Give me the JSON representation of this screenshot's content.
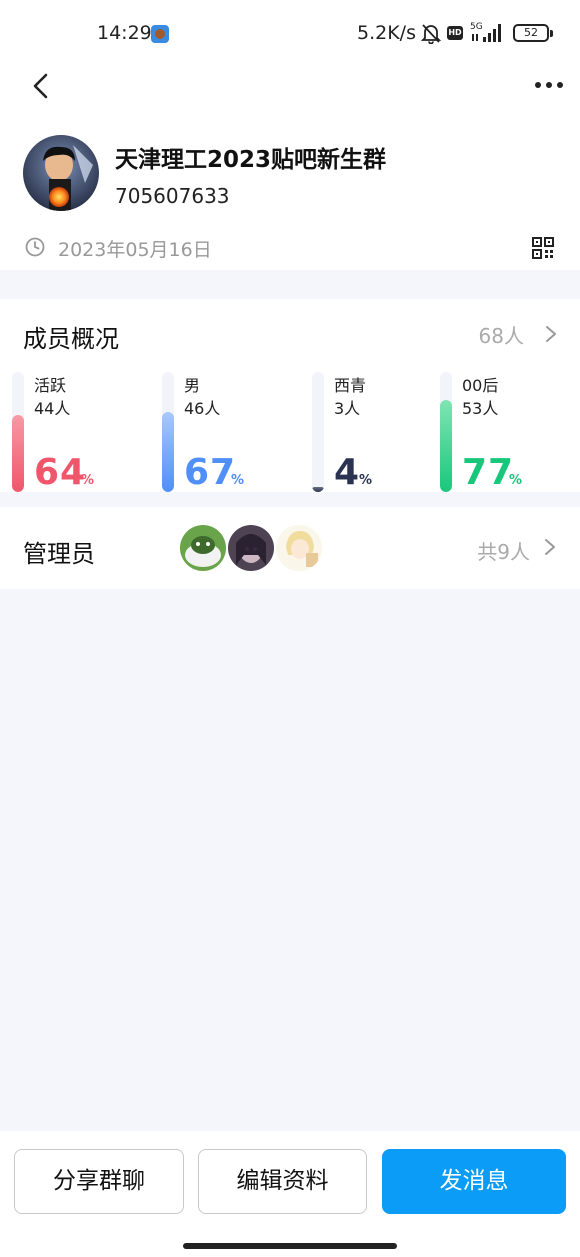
{
  "status_bar": {
    "time": "14:29",
    "network_speed": "5.2K/s",
    "signal": "5G",
    "battery": "52"
  },
  "header": {
    "group_name": "天津理工2023贴吧新生群",
    "group_id": "705607633",
    "created_date": "2023年05月16日"
  },
  "members": {
    "title": "成员概况",
    "total": "68人",
    "stats": [
      {
        "label": "活跃",
        "count": "44人",
        "percent": "64",
        "sign": "%",
        "value": 64,
        "color": "#f0566a",
        "fill_from": "#f79aa5"
      },
      {
        "label": "男",
        "count": "46人",
        "percent": "67",
        "sign": "%",
        "value": 67,
        "color": "#4f8ff7",
        "fill_from": "#a8c8fb"
      },
      {
        "label": "西青",
        "count": "3人",
        "percent": "4",
        "sign": "%",
        "value": 4,
        "color": "#2b3352",
        "fill_from": "#6b7184"
      },
      {
        "label": "00后",
        "count": "53人",
        "percent": "77",
        "sign": "%",
        "value": 77,
        "color": "#19c77a",
        "fill_from": "#7fe5b3"
      }
    ]
  },
  "admins": {
    "title": "管理员",
    "count": "共9人"
  },
  "buttons": {
    "share": "分享群聊",
    "edit": "编辑资料",
    "message": "发消息"
  }
}
